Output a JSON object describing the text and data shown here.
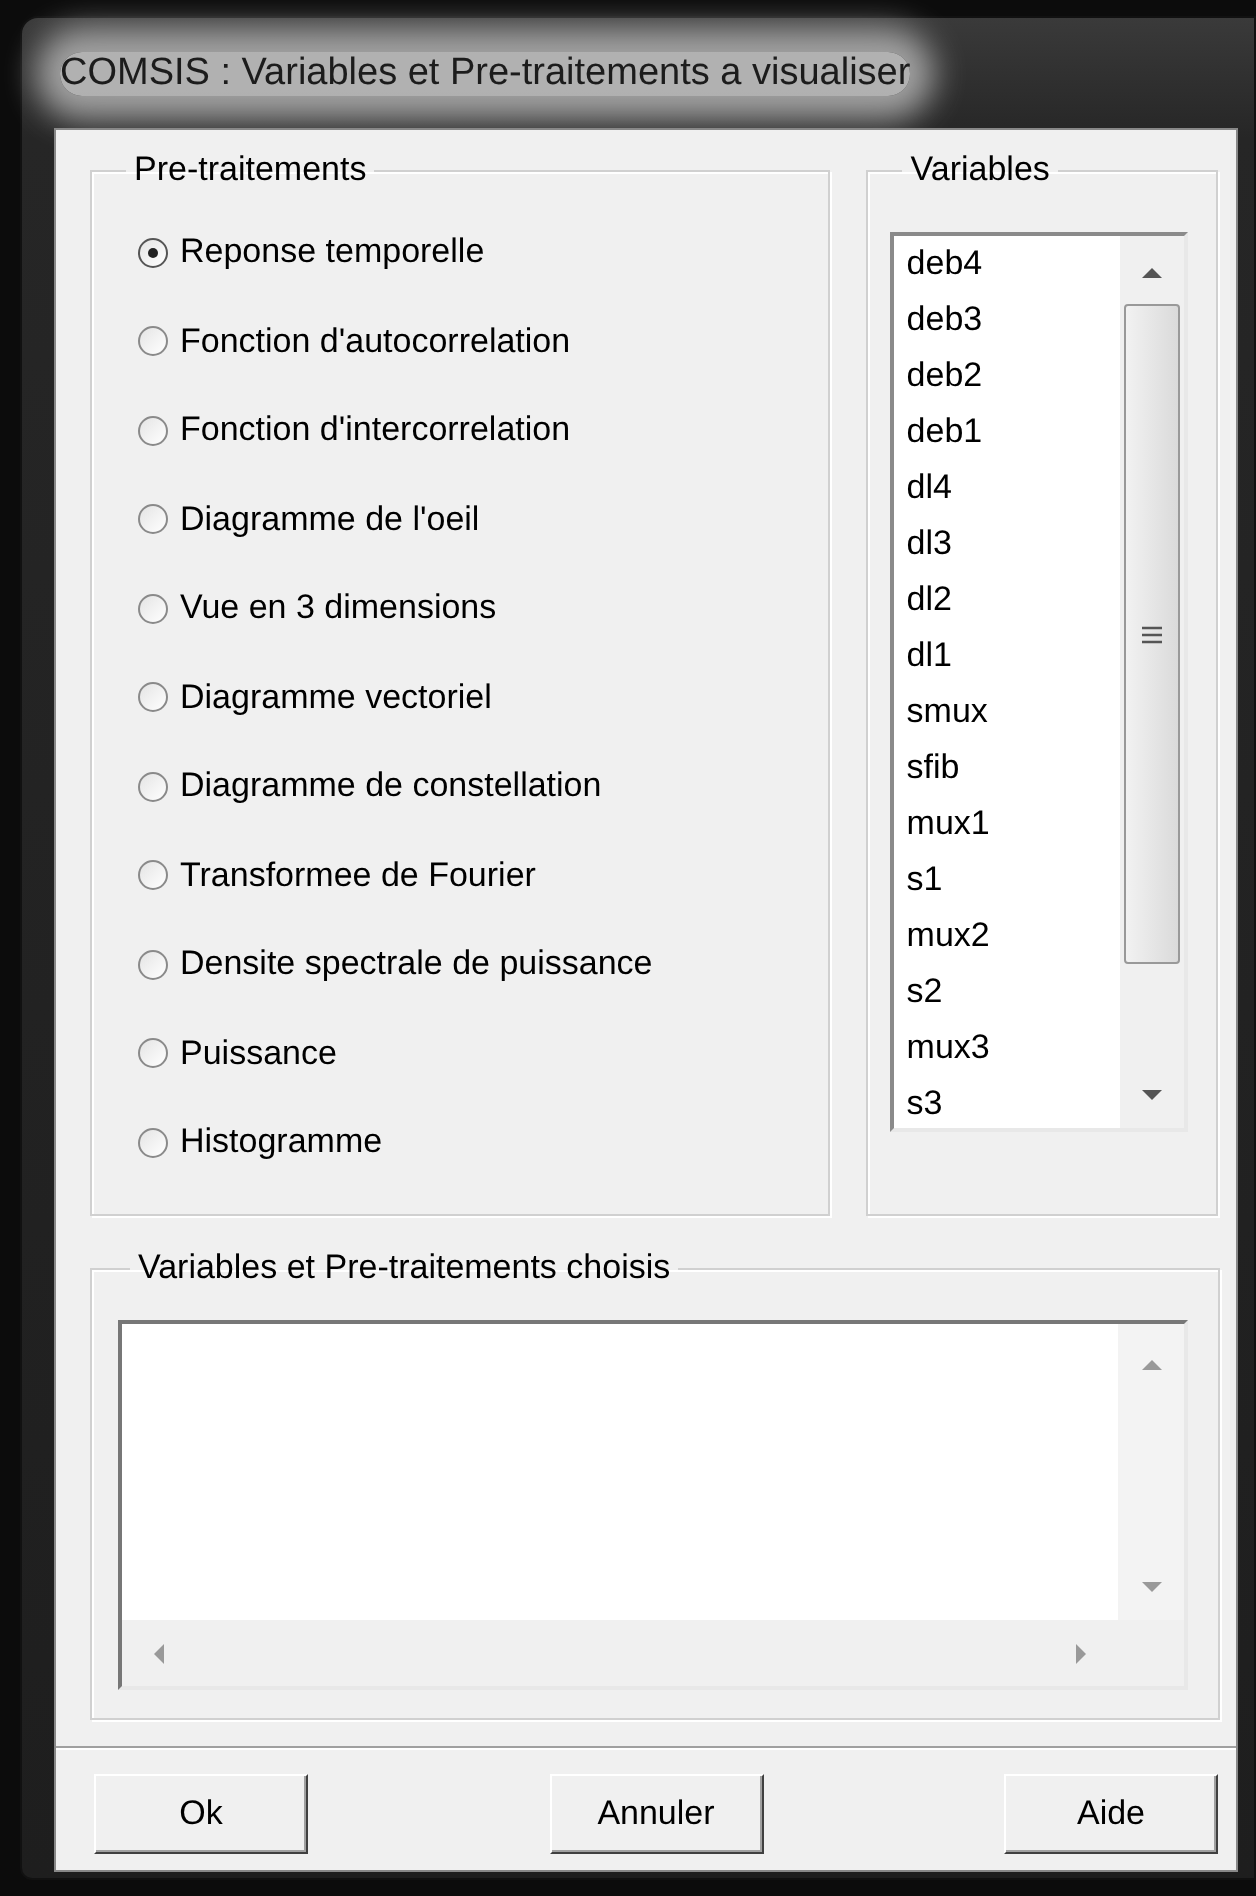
{
  "window": {
    "title": "COMSIS : Variables et Pre-traitements a visualiser"
  },
  "pretraitements": {
    "label": "Pre-traitements",
    "options": [
      {
        "label": "Reponse temporelle",
        "selected": true
      },
      {
        "label": "Fonction d'autocorrelation",
        "selected": false
      },
      {
        "label": "Fonction d'intercorrelation",
        "selected": false
      },
      {
        "label": "Diagramme de l'oeil",
        "selected": false
      },
      {
        "label": "Vue en 3 dimensions",
        "selected": false
      },
      {
        "label": "Diagramme vectoriel",
        "selected": false
      },
      {
        "label": "Diagramme de constellation",
        "selected": false
      },
      {
        "label": "Transformee de Fourier",
        "selected": false
      },
      {
        "label": "Densite spectrale de puissance",
        "selected": false
      },
      {
        "label": "Puissance",
        "selected": false
      },
      {
        "label": "Histogramme",
        "selected": false
      }
    ]
  },
  "variables": {
    "label": "Variables",
    "items": [
      "deb4",
      "deb3",
      "deb2",
      "deb1",
      "dl4",
      "dl3",
      "dl2",
      "dl1",
      "smux",
      "sfib",
      "mux1",
      "s1",
      "mux2",
      "s2",
      "mux3",
      "s3"
    ]
  },
  "chosen": {
    "label": "Variables et Pre-traitements choisis"
  },
  "buttons": [
    "Ok",
    "Annuler",
    "Aide"
  ]
}
